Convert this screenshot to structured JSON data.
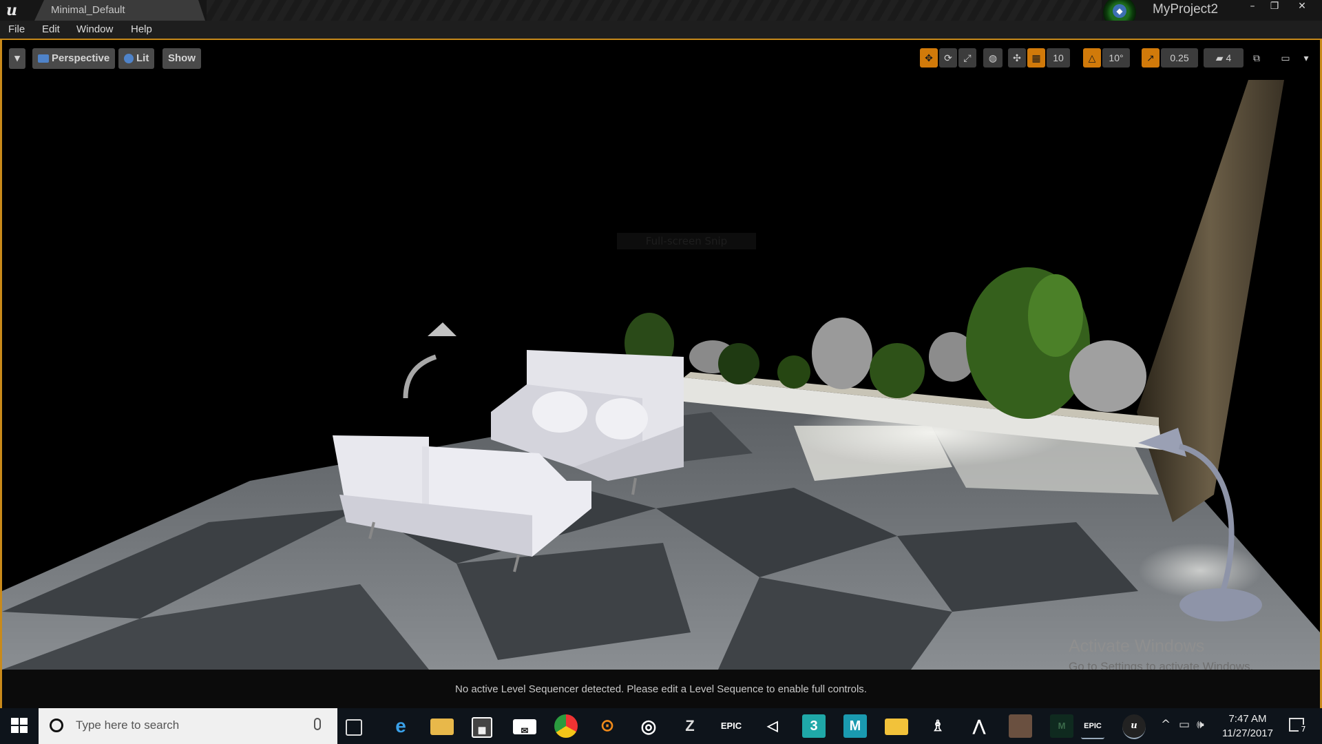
{
  "titlebar": {
    "tab_title": "Minimal_Default",
    "project_name": "MyProject2",
    "minimize": "–",
    "restore": "❐",
    "close": "✕"
  },
  "menu": [
    "File",
    "Edit",
    "Window",
    "Help"
  ],
  "viewport_toolbar": {
    "dropdown": "▾",
    "perspective": "Perspective",
    "lit": "Lit",
    "show": "Show",
    "grid_snap": "10",
    "rotation_snap": "10°",
    "scale_snap": "0.25",
    "camera_speed": "4",
    "layout_menu": "▾"
  },
  "overlay": {
    "full_screen_snip": "Full-screen Snip",
    "activate_title": "Activate Windows",
    "activate_sub": "Go to Settings to activate Windows."
  },
  "status_message": "No active Level Sequencer detected. Please edit a Level Sequence to enable full controls.",
  "taskbar": {
    "search_placeholder": "Type here to search",
    "apps": [
      "task-view",
      "edge",
      "file-explorer",
      "store",
      "mail",
      "chrome",
      "blender",
      "app-ring",
      "zbrush",
      "epic-games",
      "unity",
      "3ds-max",
      "maya",
      "paint",
      "app-a",
      "app-triangle",
      "app-photo",
      "app-m",
      "epic-games-launcher",
      "unreal-engine"
    ],
    "epic_label": "EPIC",
    "max_label": "3",
    "maya_label": "M",
    "time": "7:47 AM",
    "date": "11/27/2017",
    "notification_count": "7"
  }
}
